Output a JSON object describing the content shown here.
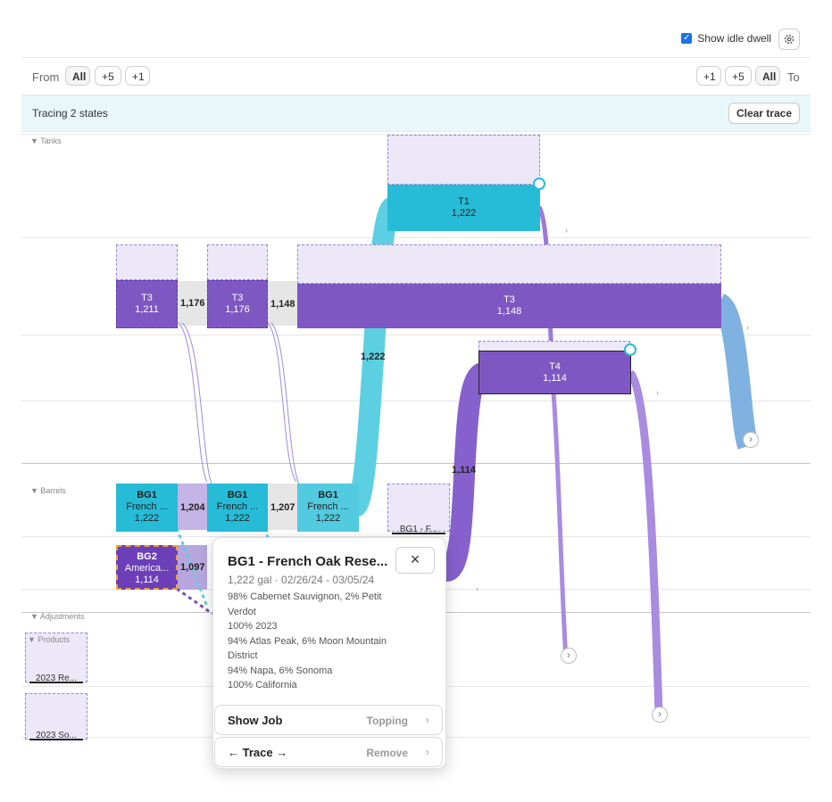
{
  "header": {
    "show_idle_dwell_label": "Show idle dwell",
    "show_idle_dwell_checked": true,
    "settings_icon": "gear-icon"
  },
  "from_row": {
    "from_label": "From",
    "from_buttons": [
      "All",
      "+5",
      "+1"
    ],
    "to_buttons": [
      "+1",
      "+5",
      "All"
    ],
    "to_label": "To"
  },
  "trace_bar": {
    "text": "Tracing 2 states",
    "clear_label": "Clear trace"
  },
  "sections": {
    "tanks": "Tanks",
    "barrels": "Barrels",
    "adjustments": "Adjustments",
    "products": "Products"
  },
  "nodes": {
    "t1": {
      "name": "T1",
      "value": "1,222"
    },
    "t3a": {
      "name": "T3",
      "value": "1,211"
    },
    "t3b": {
      "name": "T3",
      "value": "1,176"
    },
    "t3c": {
      "name": "T3",
      "value": "1,148"
    },
    "t4": {
      "name": "T4",
      "value": "1,114"
    },
    "bg1a": {
      "name": "BG1",
      "sub": "French ...",
      "value": "1,222"
    },
    "bg1b": {
      "name": "BG1",
      "sub": "French ...",
      "value": "1,222"
    },
    "bg1c": {
      "name": "BG1",
      "sub": "French ...",
      "value": "1,222"
    },
    "bg1ghost": {
      "name": "BG1 - F..."
    },
    "bg2": {
      "name": "BG2",
      "sub": "America...",
      "value": "1,114"
    },
    "prod1": {
      "name": "2023 Re..."
    },
    "prod2": {
      "name": "2023 So..."
    }
  },
  "edge_labels": {
    "e1176": "1,176",
    "e1148": "1,148",
    "e1222": "1,222",
    "e1114": "1,114",
    "e1204": "1,204",
    "e1207": "1,207",
    "e1097": "1,097"
  },
  "popup": {
    "title": "BG1 - French Oak Rese...",
    "subtitle": "1,222 gal · 02/26/24 - 03/05/24",
    "info": [
      "98% Cabernet Sauvignon, 2% Petit Verdot",
      "100% 2023",
      "94% Atlas Peak, 6% Moon Mountain District",
      "94% Napa, 6% Sonoma",
      "100% California"
    ],
    "show_job_label": "Show Job",
    "show_job_value": "Topping",
    "trace_label": "← Trace →",
    "trace_value": "Remove"
  },
  "colors": {
    "purple": "#7e57c2",
    "cyan": "#26bcd7",
    "trace_bg": "#e9f7fb"
  }
}
